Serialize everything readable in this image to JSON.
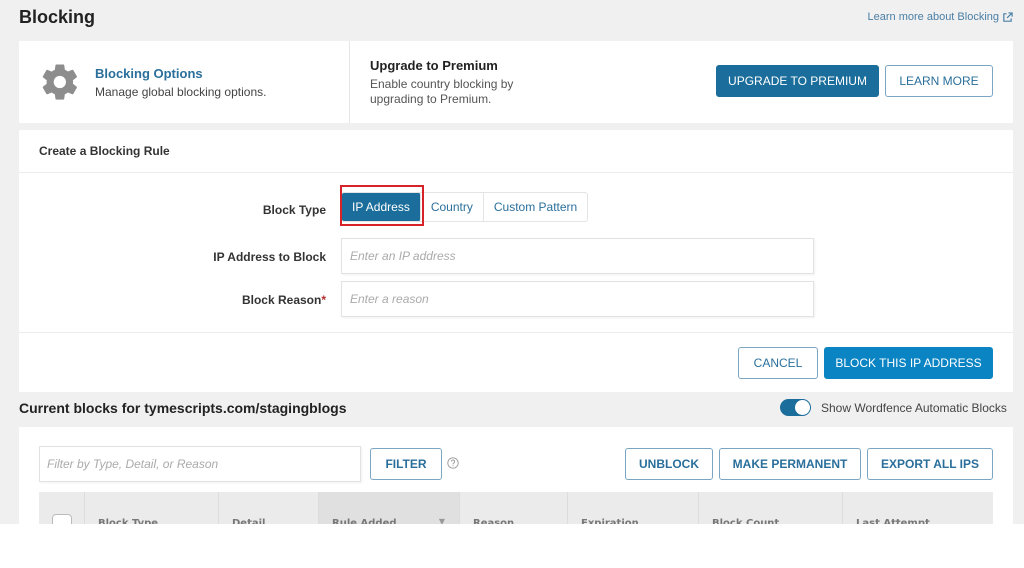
{
  "header": {
    "title": "Blocking",
    "learn_more_link": "Learn more about Blocking",
    "learn_more_icon": "external-link-icon"
  },
  "options_card": {
    "icon": "gear-icon",
    "title": "Blocking Options",
    "description": "Manage global blocking options.",
    "premium_title": "Upgrade to Premium",
    "premium_description": "Enable country blocking by upgrading to Premium.",
    "upgrade_button": "UPGRADE TO PREMIUM",
    "learn_more_button": "LEARN MORE"
  },
  "create_rule": {
    "heading": "Create a Blocking Rule",
    "block_type_label": "Block Type",
    "block_types": [
      {
        "label": "IP Address",
        "active": true
      },
      {
        "label": "Country",
        "active": false
      },
      {
        "label": "Custom Pattern",
        "active": false
      }
    ],
    "ip_label": "IP Address to Block",
    "ip_placeholder": "Enter an IP address",
    "ip_value": "",
    "reason_label": "Block Reason",
    "reason_required_mark": "*",
    "reason_placeholder": "Enter a reason",
    "reason_value": "",
    "cancel_button": "CANCEL",
    "submit_button": "BLOCK THIS IP ADDRESS"
  },
  "current_blocks": {
    "title": "Current blocks for tymescripts.com/stagingblogs",
    "toggle_label": "Show Wordfence Automatic Blocks",
    "toggle_on": true,
    "filter_placeholder": "Filter by Type, Detail, or Reason",
    "filter_value": "",
    "filter_button": "FILTER",
    "help_icon": "question-circle-icon",
    "unblock_button": "UNBLOCK",
    "make_permanent_button": "MAKE PERMANENT",
    "export_button": "EXPORT ALL IPS",
    "columns": [
      "Block Type",
      "Detail",
      "Rule Added",
      "Reason",
      "Expiration",
      "Block Count",
      "Last Attempt"
    ],
    "sorted_column": "Rule Added",
    "select_all_checked": false
  },
  "colors": {
    "primary": "#1b6d9b",
    "primary_bright": "#0b84c3",
    "highlight_box": "#d6232a",
    "background": "#f0f0f1"
  }
}
